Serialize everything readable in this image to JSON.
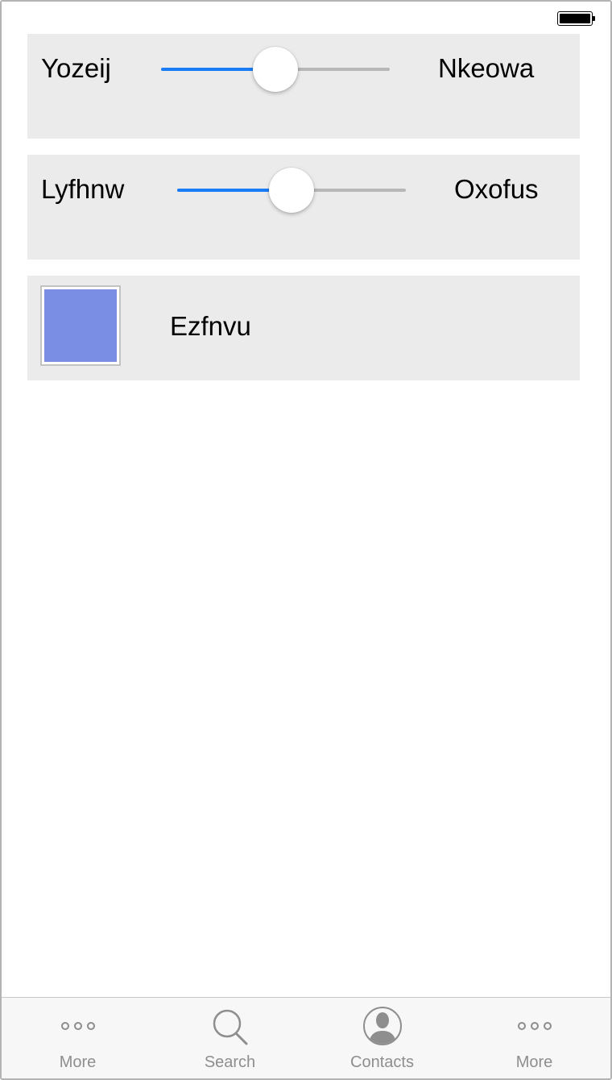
{
  "sliders": [
    {
      "left_label": "Yozeij",
      "right_label": "Nkeowa",
      "value": 0.5
    },
    {
      "left_label": "Lyfhnw",
      "right_label": "Oxofus",
      "value": 0.5
    }
  ],
  "color_row": {
    "label": "Ezfnvu",
    "color": "#7a8fe3"
  },
  "tabbar": {
    "tabs": [
      {
        "label": "More",
        "icon": "more-icon"
      },
      {
        "label": "Search",
        "icon": "search-icon"
      },
      {
        "label": "Contacts",
        "icon": "contacts-icon"
      },
      {
        "label": "More",
        "icon": "more-icon"
      }
    ]
  },
  "colors": {
    "accent": "#1a7cf5",
    "track": "#b7b7b7",
    "row_bg": "#ebebeb",
    "tab_icon": "#8e8e8e"
  }
}
